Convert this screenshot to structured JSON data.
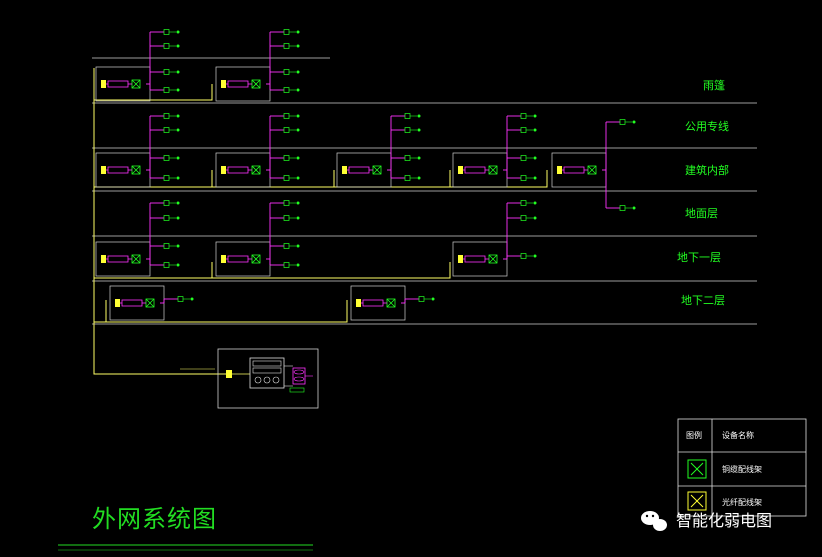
{
  "floors": [
    {
      "id": "roof",
      "label": "雨篷"
    },
    {
      "id": "public",
      "label": "公用专线"
    },
    {
      "id": "interior",
      "label": "建筑内部"
    },
    {
      "id": "ground",
      "label": "地面层"
    },
    {
      "id": "b1",
      "label": "地下一层"
    },
    {
      "id": "b2",
      "label": "地下二层"
    }
  ],
  "legend": {
    "header_left": "图例",
    "header_right": "设备名称",
    "row1": "铜缆配线架",
    "row2": "光纤配线架"
  },
  "drawing_title": "外网系统图",
  "watermark": "智能化弱电图",
  "colors": {
    "background": "#000000",
    "floor_line": "#d0d0d0",
    "trunk": "#ffff66",
    "branch": "#ff33ff",
    "device": "#22ff22",
    "label": "#22ff22"
  }
}
